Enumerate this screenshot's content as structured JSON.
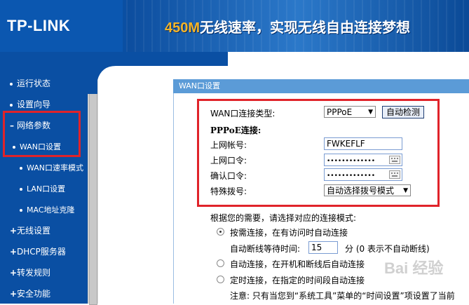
{
  "header": {
    "logo": "TP-LINK",
    "slogan_accent": "450M",
    "slogan_text": "无线速率，实现无线自由连接梦想"
  },
  "sidebar": {
    "items": [
      {
        "label": "运行状态"
      },
      {
        "label": "设置向导"
      },
      {
        "label": "网络参数"
      },
      {
        "label": "WAN口设置"
      },
      {
        "label": "WAN口速率模式"
      },
      {
        "label": "LAN口设置"
      },
      {
        "label": "MAC地址克隆"
      },
      {
        "label": "无线设置"
      },
      {
        "label": "DHCP服务器"
      },
      {
        "label": "转发规则"
      },
      {
        "label": "安全功能"
      }
    ]
  },
  "panel": {
    "title": "WAN口设置",
    "conn_type_label": "WAN口连接类型:",
    "conn_type_value": "PPPoE",
    "detect_button": "自动检测",
    "pppoe_heading": "PPPoE连接:",
    "account_label": "上网帐号:",
    "account_value": "FWKEFLF",
    "password_label": "上网口令:",
    "password_dots": "•••••••••••••",
    "confirm_label": "确认口令:",
    "confirm_dots": "•••••••••••••",
    "dial_label": "特殊拨号:",
    "dial_value": "自动选择拨号模式",
    "mode_intro": "根据您的需要，请选择对应的连接模式:",
    "mode_on_demand": "按需连接，在有访问时自动连接",
    "idle_label": "自动断线等待时间:",
    "idle_value": "15",
    "idle_unit": "分 (0 表示不自动断线)",
    "mode_auto": "自动连接，在开机和断线后自动连接",
    "mode_timed": "定时连接，在指定的时间段自动连接",
    "note": "注意: 只有当您到“系统工具”菜单的“时间设置”项设置了当前"
  },
  "watermark": "Bai 经验",
  "colors": {
    "nav_blue": "#0a4fa3",
    "highlight_red": "#e0232a",
    "title_bar": "#5b9bd7",
    "accent": "#f5b428"
  }
}
